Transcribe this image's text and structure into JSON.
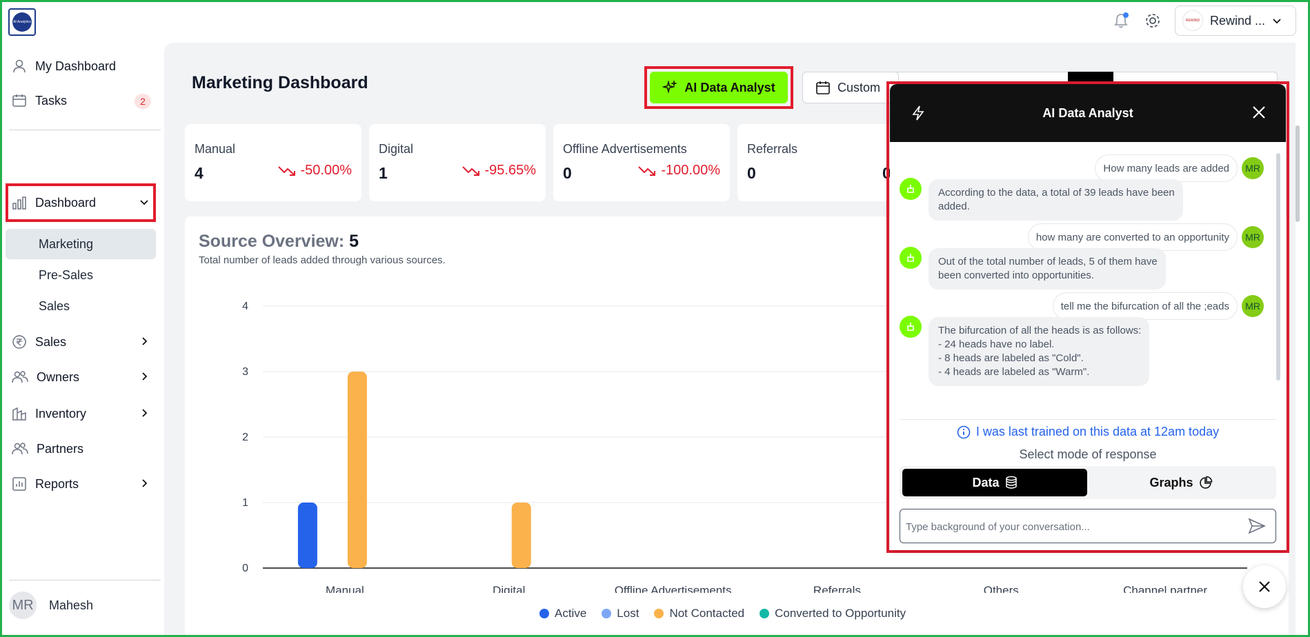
{
  "app": {
    "logo_text": "AI Analytics",
    "account_name": "Rewind ...",
    "account_logo_text": "REWIND"
  },
  "sidebar": {
    "items": [
      {
        "label": "My Dashboard",
        "icon": "user-icon"
      },
      {
        "label": "Tasks",
        "icon": "calendar-icon",
        "badge": "2"
      },
      {
        "label": "Dashboard",
        "icon": "bar-chart-icon",
        "expanded": true
      },
      {
        "label": "Sales",
        "icon": "rupee-icon"
      },
      {
        "label": "Owners",
        "icon": "users-icon"
      },
      {
        "label": "Inventory",
        "icon": "building-icon"
      },
      {
        "label": "Partners",
        "icon": "users-icon"
      },
      {
        "label": "Reports",
        "icon": "report-icon"
      }
    ],
    "dashboard_sub": [
      "Marketing",
      "Pre-Sales",
      "Sales"
    ],
    "active_sub": "Marketing",
    "user": {
      "initials": "MR",
      "name": "Mahesh"
    }
  },
  "header": {
    "title": "Marketing Dashboard",
    "ai_button": "AI Data Analyst",
    "date_button": "Custom"
  },
  "cards": [
    {
      "label": "Manual",
      "value": "4",
      "trend": "-50.00%"
    },
    {
      "label": "Digital",
      "value": "1",
      "trend": "-95.65%"
    },
    {
      "label": "Offline Advertisements",
      "value": "0",
      "trend": "-100.00%"
    },
    {
      "label": "Referrals",
      "value": "0",
      "partial_value": "0"
    }
  ],
  "overview": {
    "title": "Source Overview:",
    "count": "5",
    "subtitle": "Total number of leads added through various sources."
  },
  "chart_data": {
    "type": "bar",
    "categories": [
      "Manual",
      "Digital",
      "Offline Advertisements",
      "Referrals",
      "Others",
      "Channel partner"
    ],
    "series": [
      {
        "name": "Active",
        "color": "#2563eb",
        "values": [
          1,
          0,
          0,
          0,
          0,
          0
        ]
      },
      {
        "name": "Lost",
        "color": "#7ea6f6",
        "values": [
          0,
          0,
          0,
          0,
          0,
          0
        ]
      },
      {
        "name": "Not Contacted",
        "color": "#fbb24c",
        "values": [
          3,
          1,
          0,
          0,
          0,
          0
        ]
      },
      {
        "name": "Converted to Opportunity",
        "color": "#14b8a6",
        "values": [
          0,
          0,
          0,
          0,
          0,
          0
        ]
      }
    ],
    "yticks": [
      "0",
      "1",
      "2",
      "3",
      "4"
    ],
    "ylim": [
      0,
      4
    ],
    "grid": true,
    "legend": "bottom"
  },
  "ai_panel": {
    "title": "AI Data Analyst",
    "messages": [
      {
        "from": "user",
        "initials": "MR",
        "text": "How many leads are added"
      },
      {
        "from": "bot",
        "lines": [
          "According to the data, a total of 39 leads have been",
          "added."
        ]
      },
      {
        "from": "user",
        "initials": "MR",
        "text": "how many are converted to an opportunity"
      },
      {
        "from": "bot",
        "lines": [
          "Out of the total number of leads, 5 of them have",
          "been converted into opportunities."
        ]
      },
      {
        "from": "user",
        "initials": "MR",
        "text": "tell me the bifurcation of all the ;eads"
      },
      {
        "from": "bot",
        "lines": [
          "The bifurcation of all the heads is as follows:",
          "- 24 heads have no label.",
          "- 8 heads are labeled as \"Cold\".",
          "- 4 heads are labeled as \"Warm\"."
        ]
      }
    ],
    "info": "I was last trained on this data at 12am today",
    "mode_label": "Select mode of response",
    "mode_data": "Data",
    "mode_graphs": "Graphs",
    "input_placeholder": "Type background of your conversation..."
  }
}
